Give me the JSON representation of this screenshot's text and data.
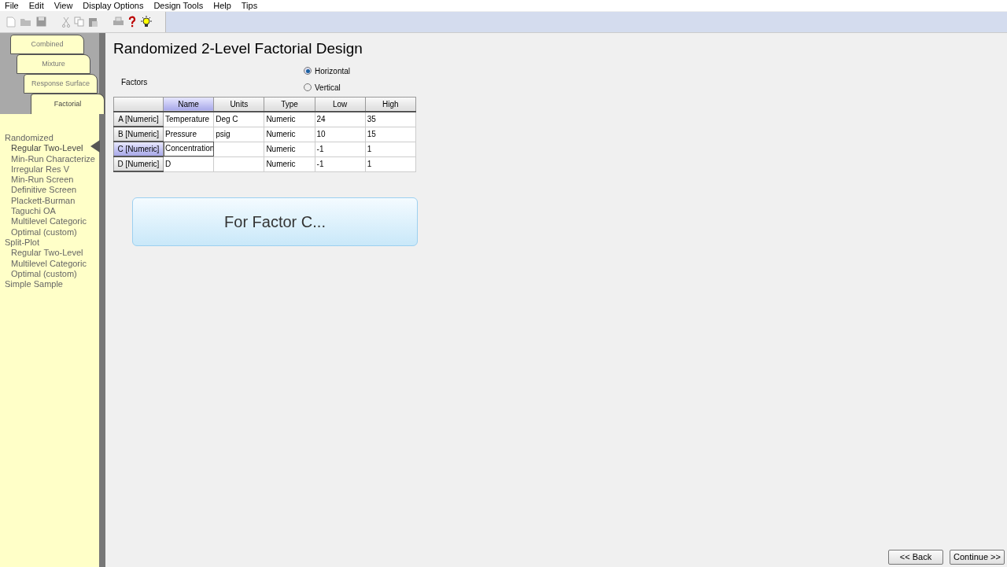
{
  "menu": [
    "File",
    "Edit",
    "View",
    "Display Options",
    "Design Tools",
    "Help",
    "Tips"
  ],
  "tabs": [
    {
      "label": "Combined",
      "selected": false
    },
    {
      "label": "Mixture",
      "selected": false
    },
    {
      "label": "Response Surface",
      "selected": false
    },
    {
      "label": "Factorial",
      "selected": true
    }
  ],
  "tree": [
    {
      "label": "Randomized",
      "selected": false,
      "children": [
        {
          "label": "Regular Two-Level",
          "selected": true
        },
        {
          "label": "Min-Run Characterize",
          "selected": false
        },
        {
          "label": "Irregular Res V",
          "selected": false
        },
        {
          "label": "Min-Run Screen",
          "selected": false
        },
        {
          "label": "Definitive Screen",
          "selected": false
        },
        {
          "label": "Plackett-Burman",
          "selected": false
        },
        {
          "label": "Taguchi OA",
          "selected": false
        },
        {
          "label": "Multilevel Categoric",
          "selected": false
        },
        {
          "label": "Optimal (custom)",
          "selected": false
        }
      ]
    },
    {
      "label": "Split-Plot",
      "selected": false,
      "children": [
        {
          "label": "Regular Two-Level",
          "selected": false
        },
        {
          "label": "Multilevel Categoric",
          "selected": false
        },
        {
          "label": "Optimal (custom)",
          "selected": false
        }
      ]
    },
    {
      "label": "Simple Sample",
      "selected": false
    }
  ],
  "title": "Randomized 2-Level Factorial Design",
  "factors_label": "Factors",
  "orientation": [
    {
      "label": "Horizontal",
      "selected": true
    },
    {
      "label": "Vertical",
      "selected": false
    }
  ],
  "table": {
    "columns": [
      {
        "label": "Name",
        "selected": true
      },
      {
        "label": "Units",
        "selected": false
      },
      {
        "label": "Type",
        "selected": false
      },
      {
        "label": "Low",
        "selected": false
      },
      {
        "label": "High",
        "selected": false
      }
    ],
    "rows": [
      {
        "header": "A [Numeric]",
        "selected": false,
        "cells": [
          "Temperature",
          "Deg C",
          "Numeric",
          "24",
          "35"
        ]
      },
      {
        "header": "B [Numeric]",
        "selected": false,
        "cells": [
          "Pressure",
          "psig",
          "Numeric",
          "10",
          "15"
        ]
      },
      {
        "header": "C [Numeric]",
        "selected": true,
        "cells": [
          "Concentration",
          "",
          "Numeric",
          "-1",
          "1"
        ]
      },
      {
        "header": "D [Numeric]",
        "selected": false,
        "cells": [
          "D",
          "",
          "Numeric",
          "-1",
          "1"
        ]
      }
    ]
  },
  "hint": "For Factor C...",
  "buttons": [
    "<< Back",
    "Continue >>"
  ]
}
